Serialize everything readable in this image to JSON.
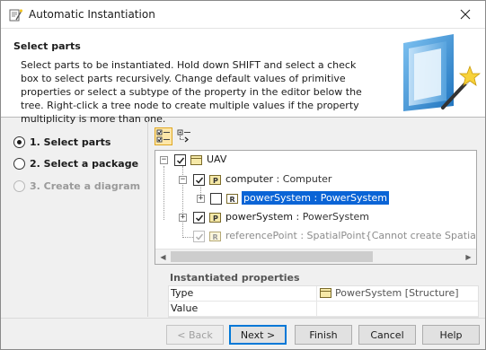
{
  "window": {
    "title": "Automatic Instantiation",
    "close_glyph": "✕"
  },
  "header": {
    "title": "Select parts",
    "description": "Select parts to be instantiated. Hold down SHIFT and select a check box to select parts recursively. Change default values of primitive properties or select a subtype of the property in the editor below the tree. Right-click a tree node to create multiple values if the property multiplicity is more than one."
  },
  "steps": [
    {
      "label": "1. Select parts",
      "state": "selected"
    },
    {
      "label": "2. Select a package",
      "state": "enabled"
    },
    {
      "label": "3. Create a diagram",
      "state": "disabled"
    }
  ],
  "toolbar": {
    "buttons": [
      {
        "icon": "select-recursively-icon",
        "active": true
      },
      {
        "icon": "expand-tree-icon",
        "active": false
      }
    ]
  },
  "tree": {
    "nodes": [
      {
        "name": "UAV",
        "type": "",
        "checked": true,
        "icon": "block-icon",
        "expander": "−"
      },
      {
        "name": "computer",
        "type": " : Computer",
        "checked": true,
        "icon": "part-icon",
        "expander": "−"
      },
      {
        "name": "powerSystem : PowerSystem",
        "type": "",
        "checked": false,
        "icon": "reference-icon",
        "expander": "+",
        "selected": true
      },
      {
        "name": "powerSystem",
        "type": " : PowerSystem",
        "checked": true,
        "icon": "part-icon",
        "expander": "+"
      },
      {
        "name": "referencePoint",
        "type": " : SpatialPoint",
        "note": "{Cannot create SpatialPoint w",
        "checked": true,
        "icon": "reference-icon",
        "disabled": true
      }
    ]
  },
  "properties": {
    "title": "Instantiated properties",
    "rows": [
      {
        "name": "Type",
        "value": "PowerSystem [Structure]",
        "icon": "block-icon"
      },
      {
        "name": "Value",
        "value": ""
      }
    ]
  },
  "buttons": {
    "back": "< Back",
    "next": "Next >",
    "finish": "Finish",
    "cancel": "Cancel",
    "help": "Help"
  },
  "colors": {
    "selection": "#0a64d6",
    "part_badge": "#f6e9a8",
    "accent": "#0078d7"
  }
}
